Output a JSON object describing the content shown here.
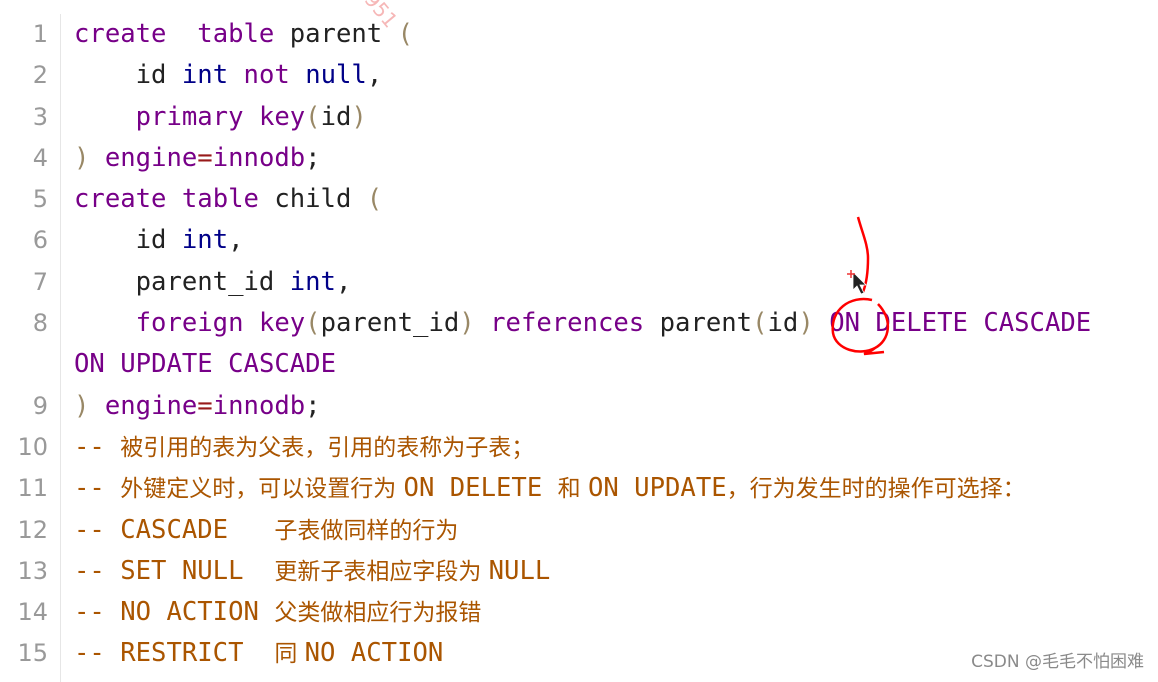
{
  "watermark_top": "951",
  "watermark_footer": "CSDN @毛毛不怕困难",
  "colors": {
    "keyword": "#770088",
    "type": "#000088",
    "comment": "#aa5500",
    "annotation": "#ff0000"
  },
  "lines": [
    {
      "n": "1",
      "tokens": [
        [
          "kw",
          "create"
        ],
        [
          "",
          "  "
        ],
        [
          "kw",
          "table"
        ],
        [
          "",
          " parent "
        ],
        [
          "pn",
          "("
        ]
      ]
    },
    {
      "n": "2",
      "tokens": [
        [
          "",
          "    id "
        ],
        [
          "ty",
          "int"
        ],
        [
          "",
          " "
        ],
        [
          "kw",
          "not"
        ],
        [
          "",
          " "
        ],
        [
          "ty",
          "null"
        ],
        [
          "",
          ","
        ]
      ]
    },
    {
      "n": "3",
      "tokens": [
        [
          "",
          "    "
        ],
        [
          "kw",
          "primary"
        ],
        [
          "",
          " "
        ],
        [
          "kw",
          "key"
        ],
        [
          "pn",
          "("
        ],
        [
          "",
          "id"
        ],
        [
          "pn",
          ")"
        ]
      ]
    },
    {
      "n": "4",
      "tokens": [
        [
          "pn",
          ")"
        ],
        [
          "",
          " "
        ],
        [
          "kw",
          "engine"
        ],
        [
          "op",
          "="
        ],
        [
          "kw",
          "innodb"
        ],
        [
          "",
          ";"
        ]
      ]
    },
    {
      "n": "5",
      "tokens": [
        [
          "kw",
          "create"
        ],
        [
          "",
          " "
        ],
        [
          "kw",
          "table"
        ],
        [
          "",
          " child "
        ],
        [
          "pn",
          "("
        ]
      ]
    },
    {
      "n": "6",
      "tokens": [
        [
          "",
          "    id "
        ],
        [
          "ty",
          "int"
        ],
        [
          "",
          ","
        ]
      ]
    },
    {
      "n": "7",
      "tokens": [
        [
          "",
          "    parent_id "
        ],
        [
          "ty",
          "int"
        ],
        [
          "",
          ","
        ]
      ]
    },
    {
      "n": "8",
      "tokens": [
        [
          "",
          "    "
        ],
        [
          "kw",
          "foreign"
        ],
        [
          "",
          " "
        ],
        [
          "kw",
          "key"
        ],
        [
          "pn",
          "("
        ],
        [
          "",
          "parent_id"
        ],
        [
          "pn",
          ")"
        ],
        [
          "",
          " "
        ],
        [
          "kw",
          "references"
        ],
        [
          "",
          " parent"
        ],
        [
          "pn",
          "("
        ],
        [
          "",
          "id"
        ],
        [
          "pn",
          ")"
        ],
        [
          "",
          " "
        ],
        [
          "kw",
          "ON"
        ],
        [
          "",
          " "
        ],
        [
          "kw",
          "DELETE"
        ],
        [
          "",
          " "
        ],
        [
          "kw",
          "CASCADE"
        ]
      ]
    },
    {
      "n": "",
      "tokens": [
        [
          "kw",
          "ON"
        ],
        [
          "",
          " "
        ],
        [
          "kw",
          "UPDATE"
        ],
        [
          "",
          " "
        ],
        [
          "kw",
          "CASCADE"
        ]
      ]
    },
    {
      "n": "9",
      "tokens": [
        [
          "pn",
          ")"
        ],
        [
          "",
          " "
        ],
        [
          "kw",
          "engine"
        ],
        [
          "op",
          "="
        ],
        [
          "kw",
          "innodb"
        ],
        [
          "",
          ";"
        ]
      ]
    },
    {
      "n": "10",
      "tokens": [
        [
          "cm",
          "-- "
        ],
        [
          "cmc",
          "被引用的表为父表，引用的表称为子表；"
        ]
      ]
    },
    {
      "n": "11",
      "tokens": [
        [
          "cm",
          "-- "
        ],
        [
          "cmc",
          "外键定义时，可以设置行为 "
        ],
        [
          "cm",
          "ON DELETE "
        ],
        [
          "cmc",
          "和 "
        ],
        [
          "cm",
          "ON UPDATE"
        ],
        [
          "cmc",
          "，行为发生时的操作可选择："
        ]
      ]
    },
    {
      "n": "12",
      "tokens": [
        [
          "cm",
          "-- CASCADE   "
        ],
        [
          "cmc",
          "子表做同样的行为"
        ]
      ]
    },
    {
      "n": "13",
      "tokens": [
        [
          "cm",
          "-- SET NULL  "
        ],
        [
          "cmc",
          "更新子表相应字段为 "
        ],
        [
          "cm",
          "NULL"
        ]
      ]
    },
    {
      "n": "14",
      "tokens": [
        [
          "cm",
          "-- NO ACTION "
        ],
        [
          "cmc",
          "父类做相应行为报错"
        ]
      ]
    },
    {
      "n": "15",
      "tokens": [
        [
          "cm",
          "-- RESTRICT  "
        ],
        [
          "cmc",
          "同 "
        ],
        [
          "cm",
          "NO ACTION"
        ]
      ]
    }
  ]
}
